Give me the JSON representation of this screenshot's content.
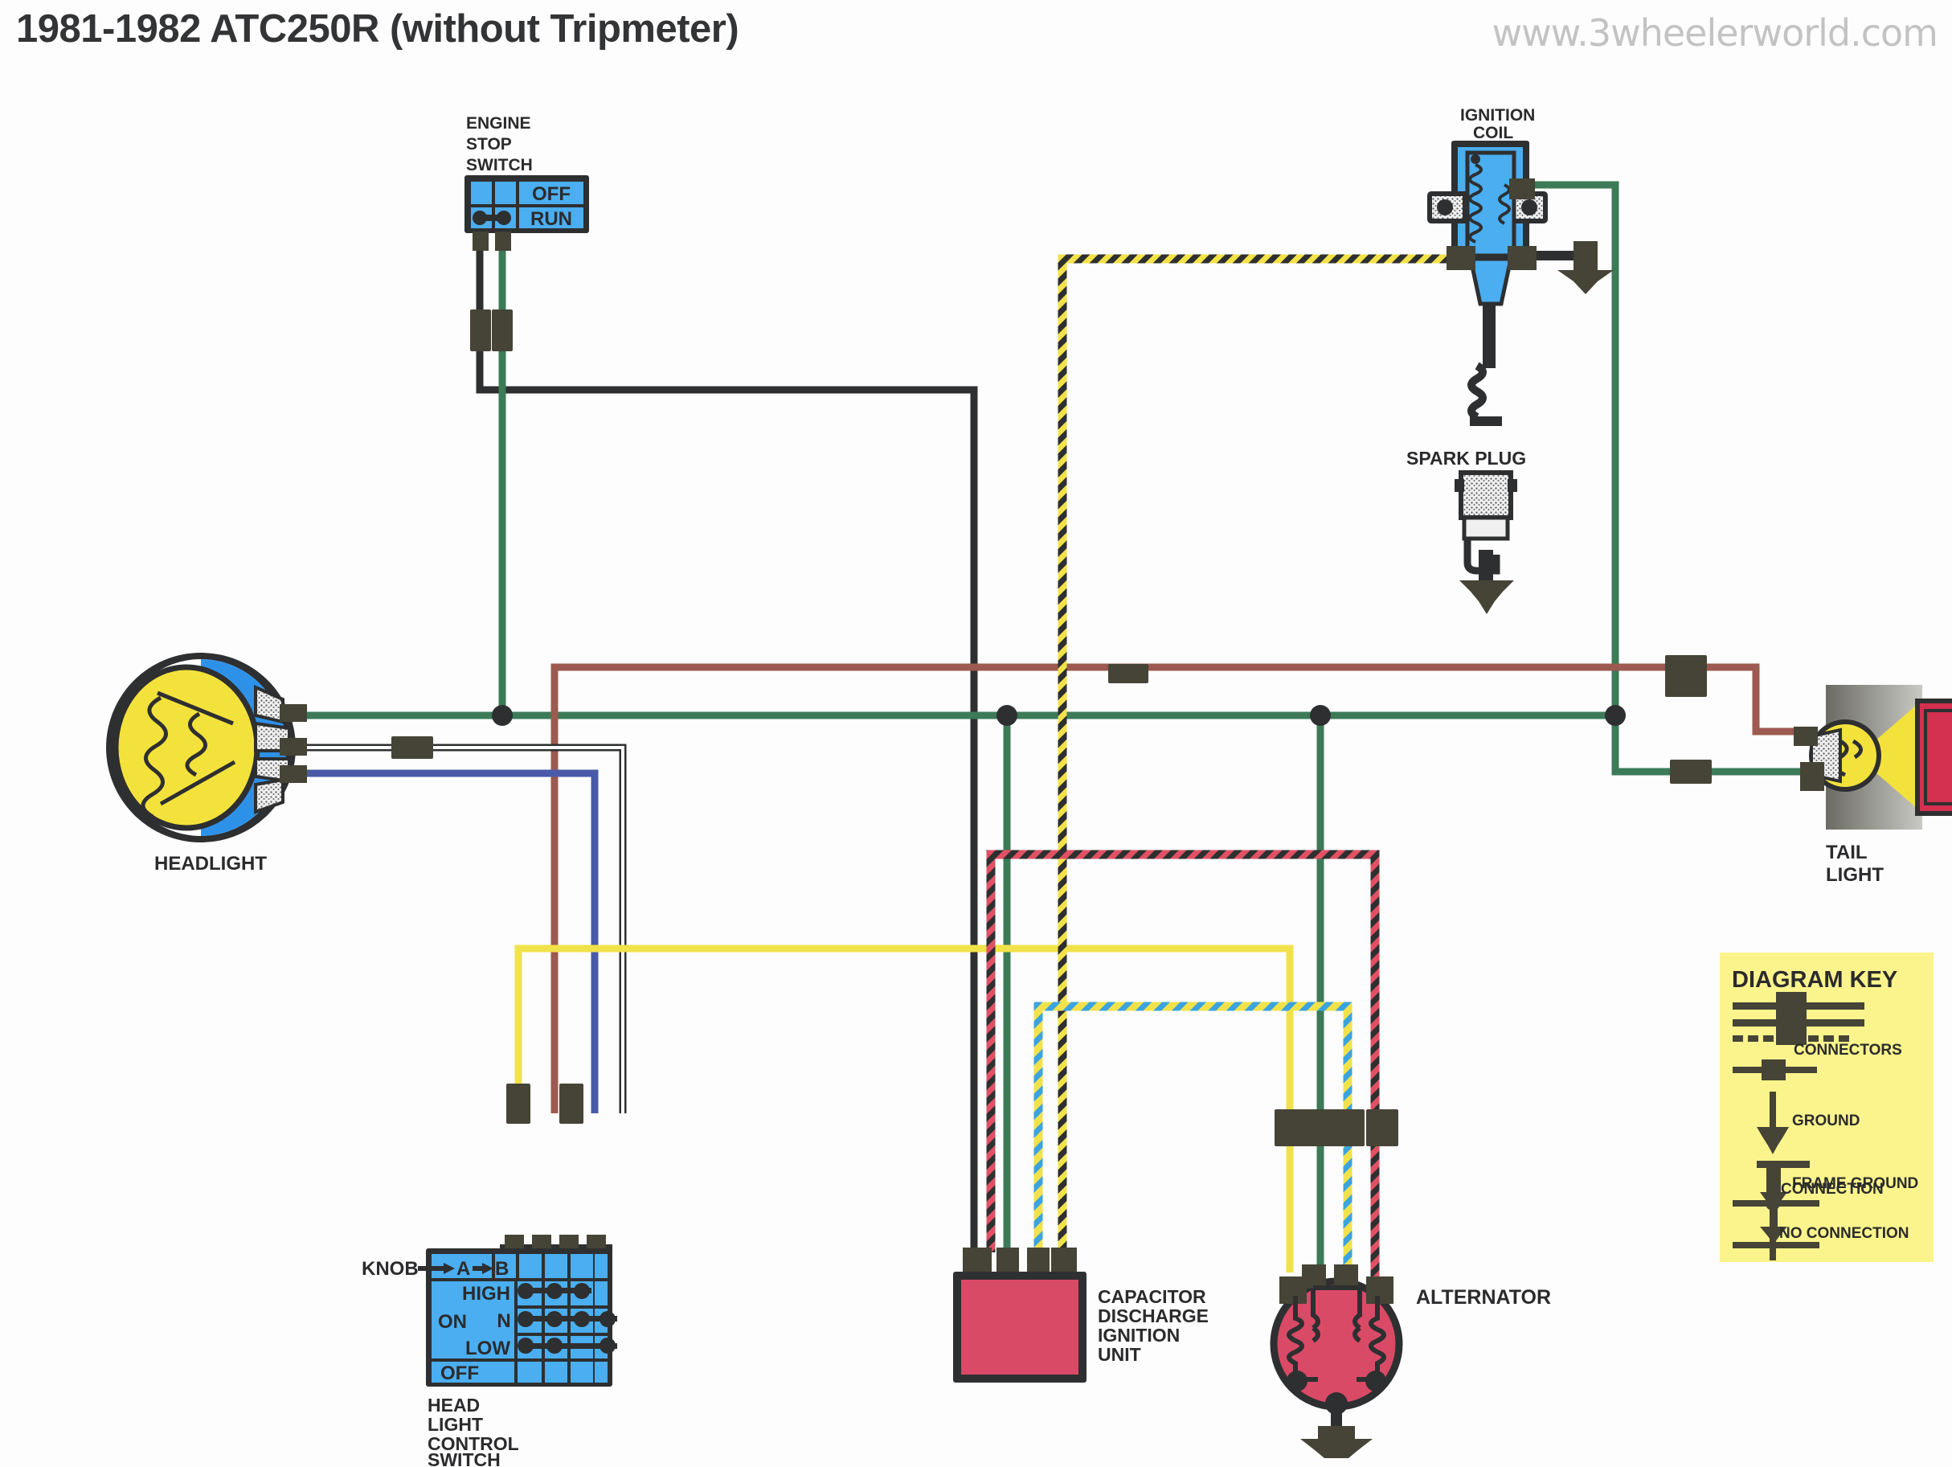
{
  "title": "1981-1982 ATC250R (without Tripmeter)",
  "watermark": "www.3wheelerworld.com",
  "components": {
    "engine_stop_switch": {
      "label_lines": [
        "ENGINE",
        "STOP",
        "SWITCH"
      ],
      "positions": [
        "OFF",
        "RUN"
      ]
    },
    "ignition_coil": {
      "label_lines": [
        "IGNITION",
        "COIL"
      ]
    },
    "spark_plug": {
      "label": "SPARK PLUG"
    },
    "headlight": {
      "label": "HEADLIGHT"
    },
    "tail_light": {
      "label_lines": [
        "TAIL",
        "LIGHT"
      ]
    },
    "headlight_control_switch": {
      "label_lines": [
        "HEAD",
        "LIGHT",
        "CONTROL",
        "SWITCH"
      ],
      "knob_label": "KNOB",
      "knob_cols": [
        "A",
        "B"
      ],
      "rows": [
        "HIGH",
        "N",
        "LOW",
        "OFF"
      ],
      "on_label": "ON"
    },
    "cdi_unit": {
      "label_lines": [
        "CAPACITOR",
        "DISCHARGE",
        "IGNITION",
        "UNIT"
      ]
    },
    "alternator": {
      "label": "ALTERNATOR"
    }
  },
  "diagram_key": {
    "title": "DIAGRAM KEY",
    "entries": [
      "CONNECTORS",
      "GROUND",
      "FRAME GROUND",
      "CONNECTION",
      "NO CONNECTION"
    ]
  },
  "colors": {
    "wire_black": "#2e2f30",
    "wire_green": "#3c7a58",
    "wire_brown_red": "#9c5a50",
    "wire_blue": "#4a5aa8",
    "wire_yellow": "#f2e24a",
    "wire_white": "#ffffff",
    "stripe_dark": "#2e2f30",
    "stripe_red": "#e05163",
    "stripe_sky": "#3aa3e0",
    "component_blue": "#4aaef0",
    "component_red": "#e24f6a",
    "key_yellow": "#fbf48c",
    "bulb_yellow": "#f4e23c",
    "connector_dark": "#454436",
    "text": "#2b2b2d",
    "watermark": "#c3c3c3"
  },
  "chart_data": {
    "type": "diagram",
    "kind": "automotive-wiring-schematic",
    "nodes": [
      "ENGINE STOP SWITCH",
      "IGNITION COIL",
      "SPARK PLUG",
      "HEADLIGHT",
      "TAIL LIGHT",
      "HEAD LIGHT CONTROL SWITCH",
      "CAPACITOR DISCHARGE IGNITION UNIT",
      "ALTERNATOR"
    ],
    "wire_colors": [
      "black",
      "green",
      "brown/red",
      "blue",
      "yellow",
      "white",
      "yellow/black stripe",
      "yellow/blue stripe",
      "red/black stripe"
    ]
  }
}
